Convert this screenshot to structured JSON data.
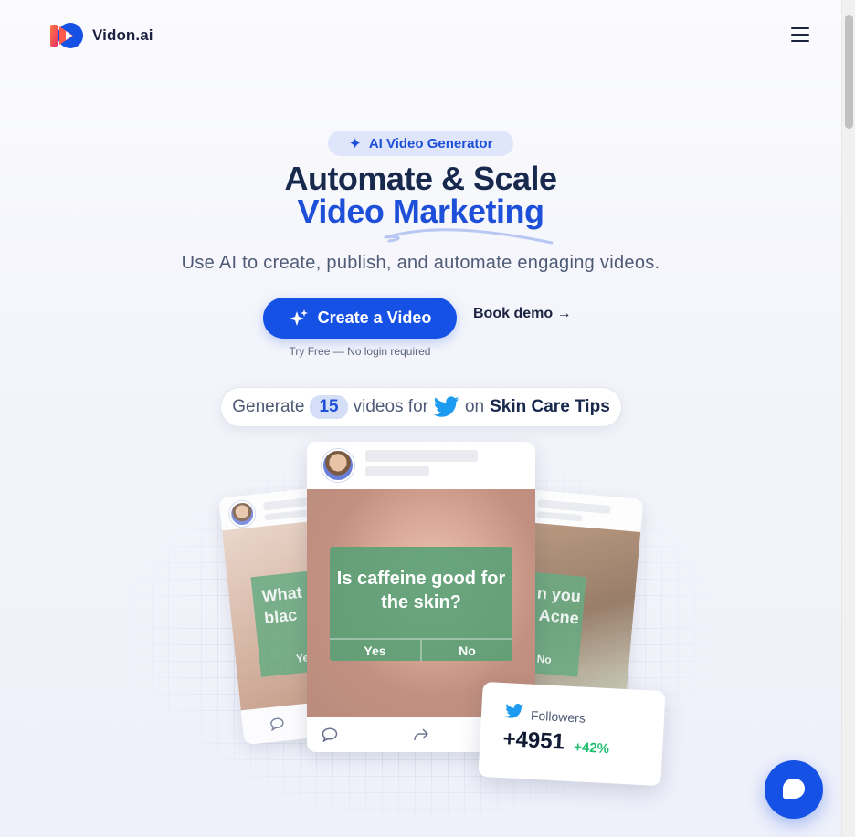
{
  "brand": {
    "name": "Vidon.ai",
    "logo_icon": "play-logo-icon",
    "accent": "#1651e6"
  },
  "header": {
    "menu_icon": "hamburger-menu-icon"
  },
  "hero": {
    "badge": "AI Video Generator",
    "badge_icon": "sparkle-icon",
    "title_line1": "Automate & Scale",
    "title_line2": "Video Marketing",
    "subtitle": "Use AI to create, publish, and automate engaging videos.",
    "cta_label": "Create a Video",
    "cta_icon": "sparkles-icon",
    "demo_label": "Book demo →",
    "try_free": "Try Free — No login required"
  },
  "generator": {
    "prefix": "Generate",
    "count": "15",
    "middle": "videos for",
    "platform_icon": "twitter-icon",
    "on": "on",
    "topic": "Skin Care Tips"
  },
  "cards": {
    "main": {
      "question": "Is caffeine good for the skin?",
      "answer_yes": "Yes",
      "answer_no": "No"
    },
    "left": {
      "text": "What blac",
      "answer": "Yes"
    },
    "right": {
      "text": "n you Acne",
      "answer": "No"
    }
  },
  "followers_card": {
    "label": "Followers",
    "count": "+4951",
    "delta": "+42%",
    "delta_color": "#1fbe6e"
  }
}
